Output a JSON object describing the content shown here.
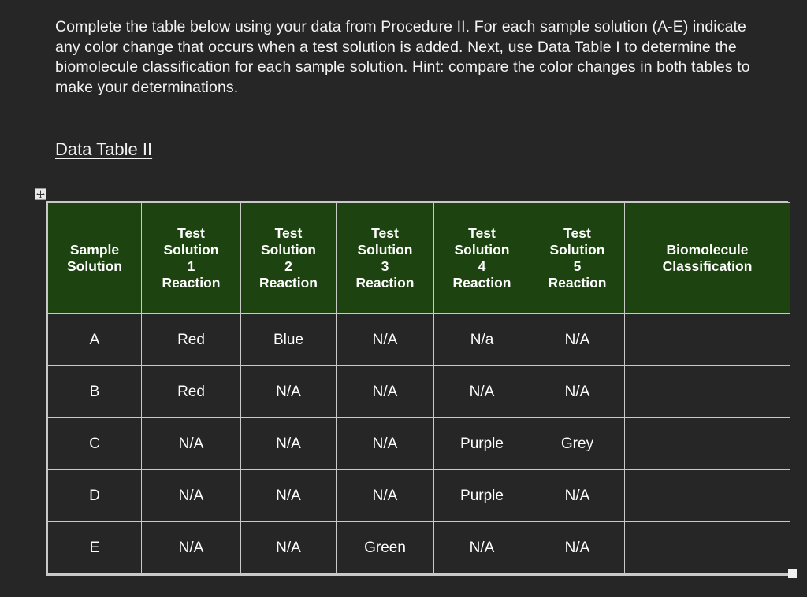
{
  "instructions": {
    "text": "Complete the table below using your data from Procedure II. For each sample solution (A-E) indicate any color change that occurs when a test solution is added. Next, use Data Table I to determine the biomolecule classification for each sample solution.  Hint: compare the color changes in both tables to make your determinations."
  },
  "section": {
    "title": "Data Table II"
  },
  "controls": {
    "move_handle_icon": "move-cross-icon",
    "resize_handle_icon": "resize-square-icon"
  },
  "colors": {
    "page_background": "#262626",
    "header_green": "#1d4410",
    "border": "#c9c9c9",
    "text": "#ffffff"
  },
  "table": {
    "headers": [
      {
        "lines": [
          "Sample",
          "Solution"
        ]
      },
      {
        "lines": [
          "Test",
          "Solution",
          "1",
          "Reaction"
        ]
      },
      {
        "lines": [
          "Test",
          "Solution",
          "2",
          "Reaction"
        ]
      },
      {
        "lines": [
          "Test",
          "Solution",
          "3",
          "Reaction"
        ]
      },
      {
        "lines": [
          "Test",
          "Solution",
          "4",
          "Reaction"
        ]
      },
      {
        "lines": [
          "Test",
          "Solution",
          "5",
          "Reaction"
        ]
      },
      {
        "lines": [
          "Biomolecule",
          "Classification"
        ]
      }
    ],
    "header_flat": [
      "Sample Solution",
      "Test Solution 1 Reaction",
      "Test Solution 2 Reaction",
      "Test Solution 3 Reaction",
      "Test Solution 4 Reaction",
      "Test Solution 5 Reaction",
      "Biomolecule Classification"
    ],
    "rows": [
      {
        "sample": "A",
        "ts1": "Red",
        "ts2": "Blue",
        "ts3": "N/A",
        "ts4": "N/a",
        "ts5": "N/A",
        "classification": ""
      },
      {
        "sample": "B",
        "ts1": "Red",
        "ts2": "N/A",
        "ts3": "N/A",
        "ts4": "N/A",
        "ts5": "N/A",
        "classification": ""
      },
      {
        "sample": "C",
        "ts1": "N/A",
        "ts2": "N/A",
        "ts3": "N/A",
        "ts4": "Purple",
        "ts5": "Grey",
        "classification": ""
      },
      {
        "sample": "D",
        "ts1": "N/A",
        "ts2": "N/A",
        "ts3": "N/A",
        "ts4": "Purple",
        "ts5": "N/A",
        "classification": ""
      },
      {
        "sample": "E",
        "ts1": "N/A",
        "ts2": "N/A",
        "ts3": "Green",
        "ts4": "N/A",
        "ts5": "N/A",
        "classification": ""
      }
    ]
  }
}
